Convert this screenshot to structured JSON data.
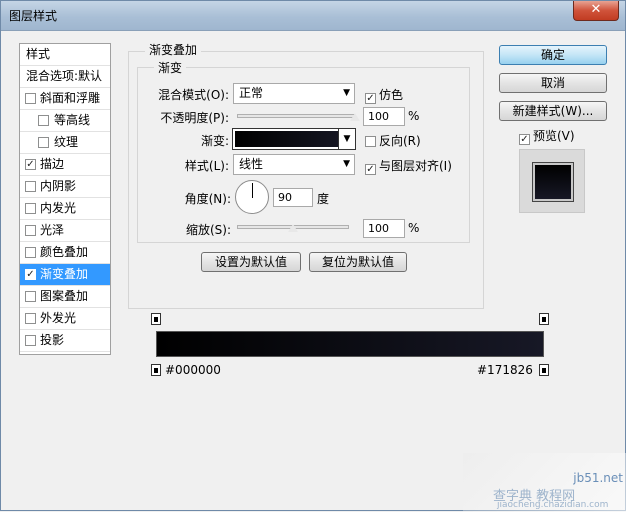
{
  "window": {
    "title": "图层样式",
    "close_glyph": "✕"
  },
  "sidebar": {
    "header": "样式",
    "blend_default": "混合选项:默认",
    "items": [
      {
        "label": "斜面和浮雕",
        "checked": false,
        "indent": false
      },
      {
        "label": "等高线",
        "checked": false,
        "indent": true
      },
      {
        "label": "纹理",
        "checked": false,
        "indent": true
      },
      {
        "label": "描边",
        "checked": true,
        "indent": false
      },
      {
        "label": "内阴影",
        "checked": false,
        "indent": false
      },
      {
        "label": "内发光",
        "checked": false,
        "indent": false
      },
      {
        "label": "光泽",
        "checked": false,
        "indent": false
      },
      {
        "label": "颜色叠加",
        "checked": false,
        "indent": false
      },
      {
        "label": "渐变叠加",
        "checked": true,
        "indent": false,
        "selected": true
      },
      {
        "label": "图案叠加",
        "checked": false,
        "indent": false
      },
      {
        "label": "外发光",
        "checked": false,
        "indent": false
      },
      {
        "label": "投影",
        "checked": false,
        "indent": false
      }
    ]
  },
  "panel": {
    "group_title": "渐变叠加",
    "subgroup_title": "渐变",
    "blend_mode_label": "混合模式(O):",
    "blend_mode_value": "正常",
    "dither_label": "仿色",
    "dither_checked": true,
    "opacity_label": "不透明度(P):",
    "opacity_value": "100",
    "opacity_fraction": 1.0,
    "percent": "%",
    "gradient_label": "渐变:",
    "reverse_label": "反向(R)",
    "reverse_checked": false,
    "style_label": "样式(L):",
    "style_value": "线性",
    "align_label": "与图层对齐(I)",
    "align_checked": true,
    "angle_label": "角度(N):",
    "angle_value": "90",
    "degree": "度",
    "scale_label": "缩放(S):",
    "scale_value": "100",
    "scale_fraction": 0.5,
    "set_default_label": "设置为默认值",
    "reset_default_label": "复位为默认值"
  },
  "right": {
    "ok_label": "确定",
    "cancel_label": "取消",
    "new_style_label": "新建样式(W)...",
    "preview_label": "预览(V)",
    "preview_checked": true
  },
  "gradient_editor": {
    "left_color": "#000000",
    "right_color": "#171826"
  },
  "watermark": {
    "line1": "jb51.net",
    "line2": "查字典 教程网",
    "line3": "jiaocheng.chazidian.com"
  }
}
